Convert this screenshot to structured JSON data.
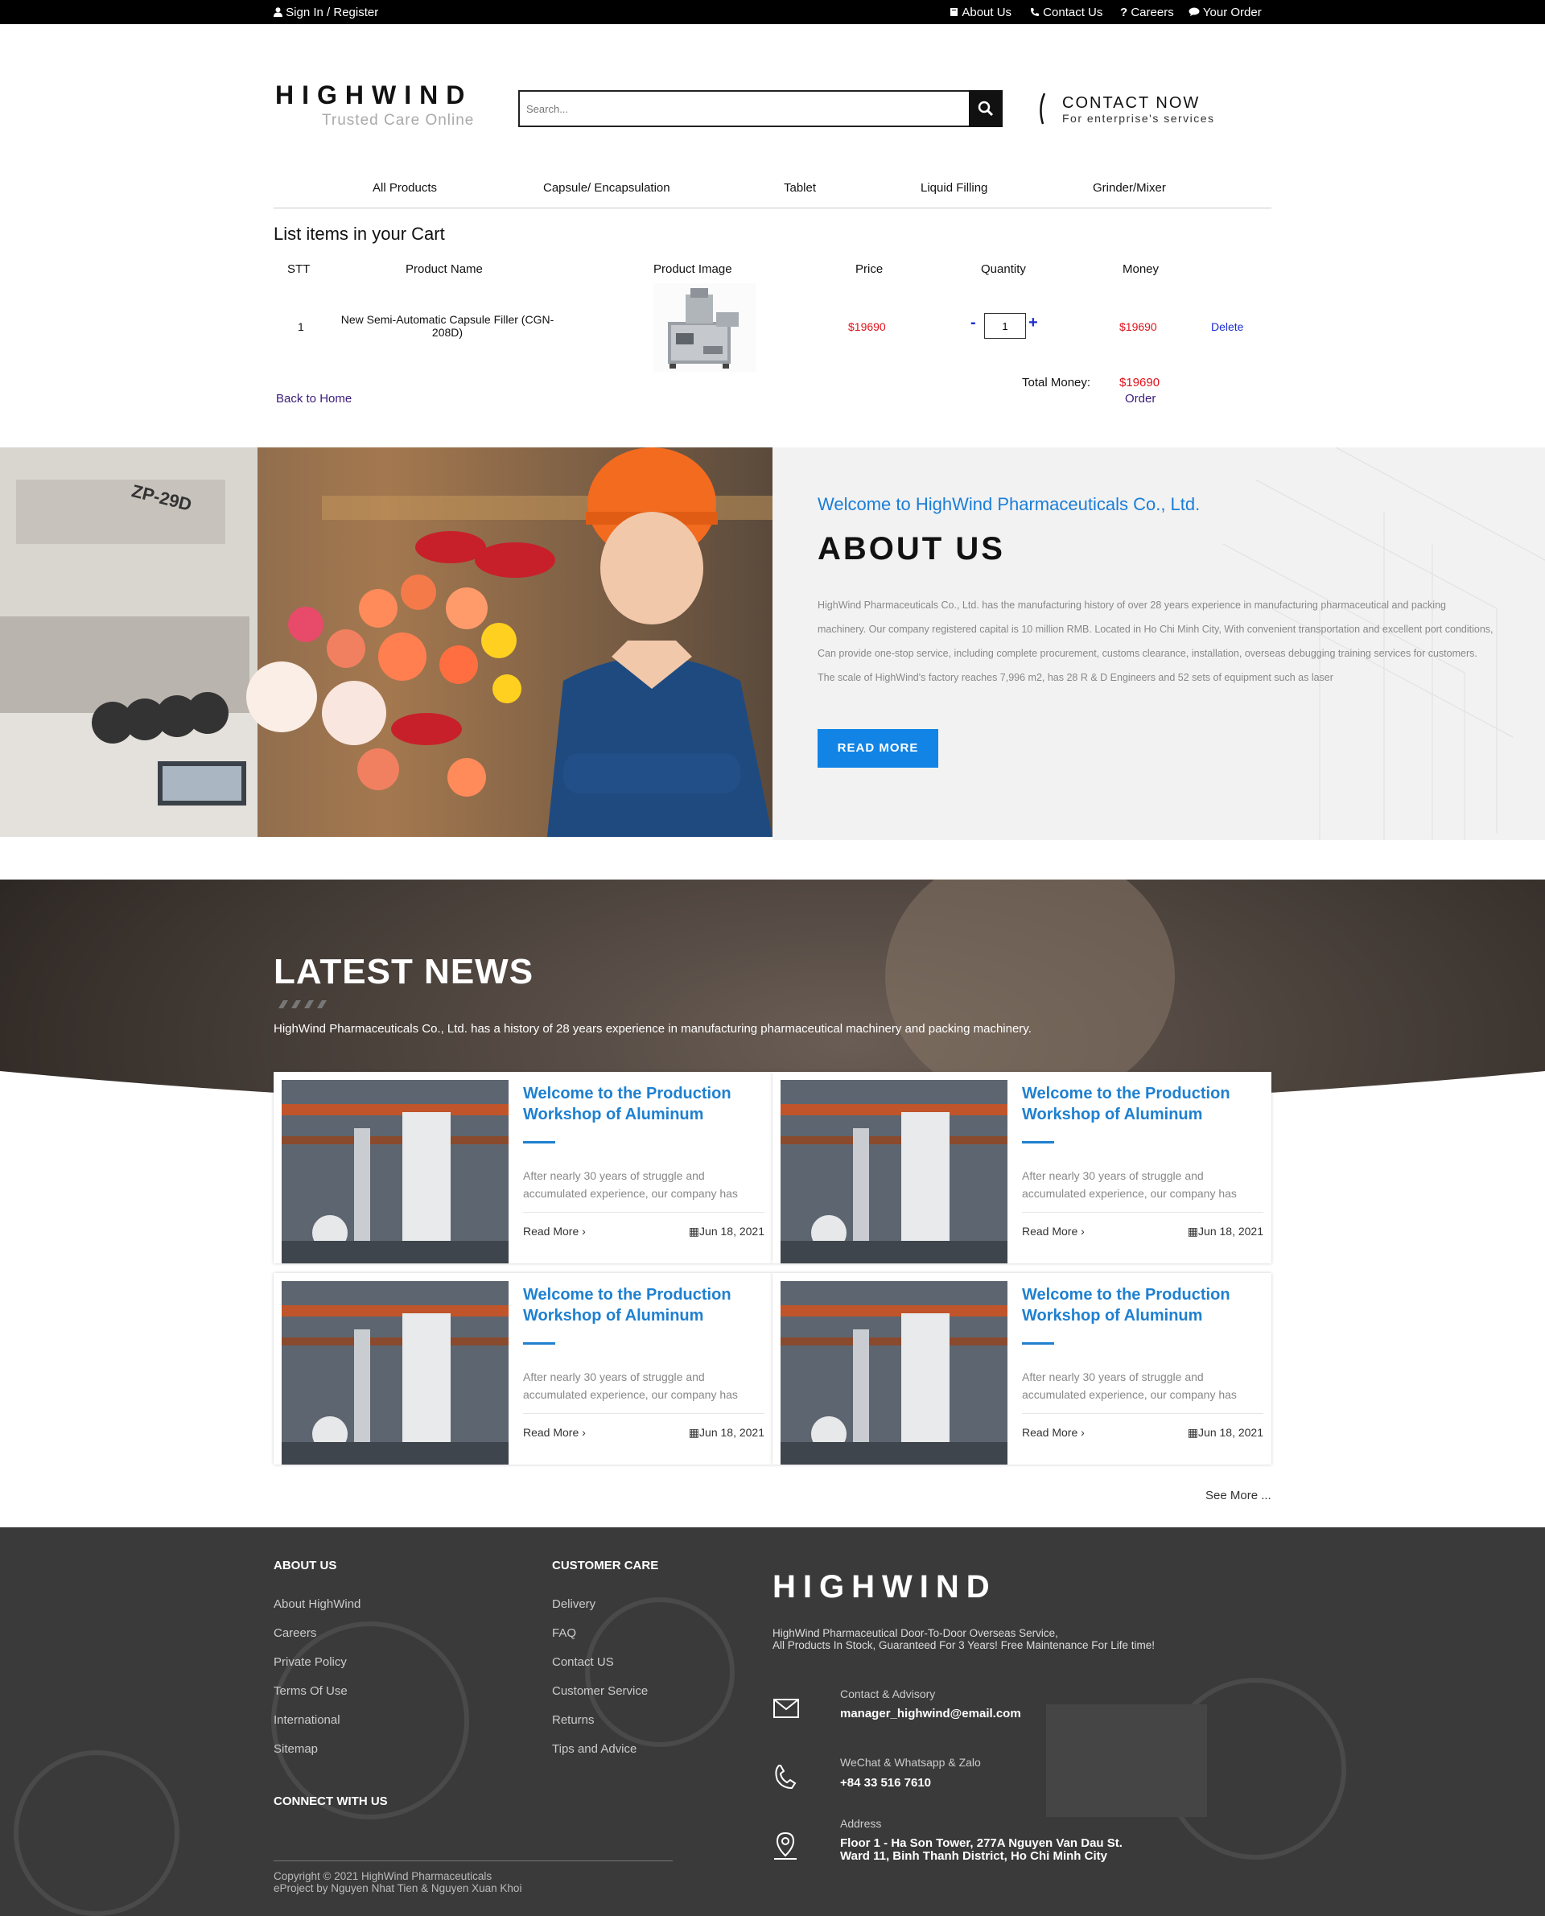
{
  "topbar": {
    "signin": "Sign In / Register",
    "about": "About Us",
    "contact": "Contact Us",
    "careers": "Careers",
    "order": "Your Order"
  },
  "header": {
    "logo": "HIGHWIND",
    "tagline": "Trusted Care Online",
    "search_placeholder": "Search...",
    "contact_now": "CONTACT NOW",
    "contact_sub": "For enterprise's services"
  },
  "nav": [
    "All Products",
    "Capsule/ Encapsulation",
    "Tablet",
    "Liquid Filling",
    "Grinder/Mixer"
  ],
  "cart": {
    "title": "List items in your Cart",
    "headers": [
      "STT",
      "Product Name",
      "Product Image",
      "Price",
      "Quantity",
      "Money"
    ],
    "row": {
      "stt": "1",
      "name_line1": "New Semi-Automatic Capsule Filler (CGN-",
      "name_line2": "208D)",
      "price": "$19690",
      "minus": "-",
      "qty": "1",
      "plus": "+",
      "money": "$19690",
      "delete": "Delete"
    },
    "back_home": "Back to Home",
    "total_label": "Total Money:",
    "total_value": "$19690",
    "order": "Order"
  },
  "about": {
    "machine_label": "ZP-29D",
    "welcome": "Welcome to HighWind Pharmaceuticals Co., Ltd.",
    "title": "ABOUT US",
    "text": "HighWind Pharmaceuticals Co., Ltd. has the manufacturing history of over 28 years experience in manufacturing pharmaceutical and packing machinery. Our company registered capital is 10 million RMB. Located in Ho Chi Minh City, With convenient transportation and excellent port conditions, Can provide one-stop service, including complete procurement, customs clearance, installation, overseas debugging training services for customers. The scale of HighWind's factory reaches 7,996 m2, has 28 R & D Engineers and 52 sets of equipment such as laser",
    "read_more": "READ MORE"
  },
  "news": {
    "title": "LATEST NEWS",
    "desc": "HighWind Pharmaceuticals Co., Ltd. has a history of 28 years experience in manufacturing pharmaceutical machinery and packing machinery.",
    "cards": [
      {
        "title": "Welcome to the Production Workshop of Aluminum",
        "excerpt": "After nearly 30 years of struggle and accumulated experience, our company has",
        "read_more": "Read More ›",
        "date": "Jun 18, 2021"
      },
      {
        "title": "Welcome to the Production Workshop of Aluminum",
        "excerpt": "After nearly 30 years of struggle and accumulated experience, our company has",
        "read_more": "Read More ›",
        "date": "Jun 18, 2021"
      },
      {
        "title": "Welcome to the Production Workshop of Aluminum",
        "excerpt": "After nearly 30 years of struggle and accumulated experience, our company has",
        "read_more": "Read More ›",
        "date": "Jun 18, 2021"
      },
      {
        "title": "Welcome to the Production Workshop of Aluminum",
        "excerpt": "After nearly 30 years of struggle and accumulated experience, our company has",
        "read_more": "Read More ›",
        "date": "Jun 18, 2021"
      }
    ],
    "see_more": "See More ..."
  },
  "footer": {
    "about_heading": "ABOUT US",
    "about_links": [
      "About HighWind",
      "Careers",
      "Private Policy",
      "Terms Of Use",
      "International",
      "Sitemap"
    ],
    "care_heading": "CUSTOMER CARE",
    "care_links": [
      "Delivery",
      "FAQ",
      "Contact US",
      "Customer Service",
      "Returns",
      "Tips and Advice"
    ],
    "connect_heading": "CONNECT WITH US",
    "logo": "HIGHWIND",
    "desc_line1": "HighWind Pharmaceutical Door-To-Door Overseas Service,",
    "desc_line2": "All Products In Stock, Guaranteed For 3 Years! Free Maintenance For Life time!",
    "contact_label": "Contact & Advisory",
    "contact_value": "manager_highwind@email.com",
    "phone_label": "WeChat & Whatsapp & Zalo",
    "phone_value": "+84 33 516 7610",
    "address_label": "Address",
    "address_line1": "Floor 1 - Ha Son Tower, 277A Nguyen Van Dau St.",
    "address_line2": "Ward 11, Binh Thanh District, Ho Chi Minh City",
    "copyright": "Copyright © 2021 HighWind Pharmaceuticals",
    "credit": "eProject by Nguyen Nhat Tien & Nguyen Xuan Khoi"
  }
}
